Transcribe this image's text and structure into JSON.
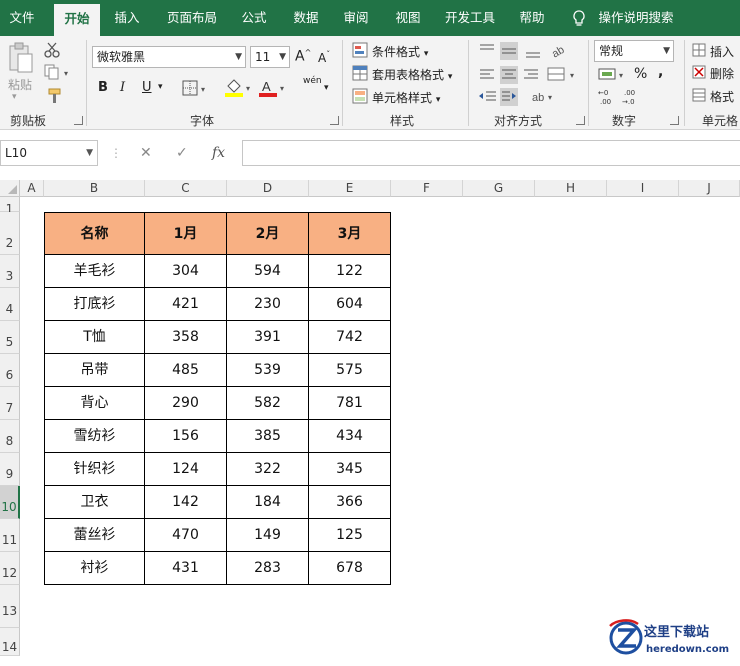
{
  "tabs": [
    "文件",
    "开始",
    "插入",
    "页面布局",
    "公式",
    "数据",
    "审阅",
    "视图",
    "开发工具",
    "帮助",
    "操作说明搜索"
  ],
  "active_tab": "开始",
  "clipboard": {
    "paste_label": "粘贴",
    "group_label": "剪贴板"
  },
  "font": {
    "family": "微软雅黑",
    "size": "11",
    "group_label": "字体",
    "bold": "B",
    "italic": "I",
    "underline": "U",
    "grow": "A",
    "shrink": "A",
    "phonetic": "wén"
  },
  "styles": {
    "conditional": "条件格式",
    "table": "套用表格格式",
    "cell": "单元格样式",
    "group_label": "样式"
  },
  "alignment": {
    "group_label": "对齐方式"
  },
  "number": {
    "format": "常规",
    "group_label": "数字",
    "percent": "%",
    "comma": ","
  },
  "cells": {
    "insert": "插入",
    "delete": "删除",
    "format": "格式",
    "group_label": "单元格"
  },
  "formula_bar": {
    "name_box": "L10",
    "cancel": "✕",
    "enter": "✓",
    "fx": "fx",
    "value": ""
  },
  "columns": [
    "A",
    "B",
    "C",
    "D",
    "E",
    "F",
    "G",
    "H",
    "I",
    "J"
  ],
  "rows": [
    "1",
    "2",
    "3",
    "4",
    "5",
    "6",
    "7",
    "8",
    "9",
    "10",
    "11",
    "12",
    "13",
    "14"
  ],
  "selected_row": "10",
  "table": {
    "headers": [
      "名称",
      "1月",
      "2月",
      "3月"
    ],
    "rows": [
      [
        "羊毛衫",
        "304",
        "594",
        "122"
      ],
      [
        "打底衫",
        "421",
        "230",
        "604"
      ],
      [
        "T恤",
        "358",
        "391",
        "742"
      ],
      [
        "吊带",
        "485",
        "539",
        "575"
      ],
      [
        "背心",
        "290",
        "582",
        "781"
      ],
      [
        "雪纺衫",
        "156",
        "385",
        "434"
      ],
      [
        "针织衫",
        "124",
        "322",
        "345"
      ],
      [
        "卫衣",
        "142",
        "184",
        "366"
      ],
      [
        "蕾丝衫",
        "470",
        "149",
        "125"
      ],
      [
        "衬衫",
        "431",
        "283",
        "678"
      ]
    ]
  },
  "watermark": {
    "name": "这里下载站",
    "url": "heredown.com"
  },
  "colors": {
    "brand": "#217346",
    "header_fill": "#f8b083"
  }
}
